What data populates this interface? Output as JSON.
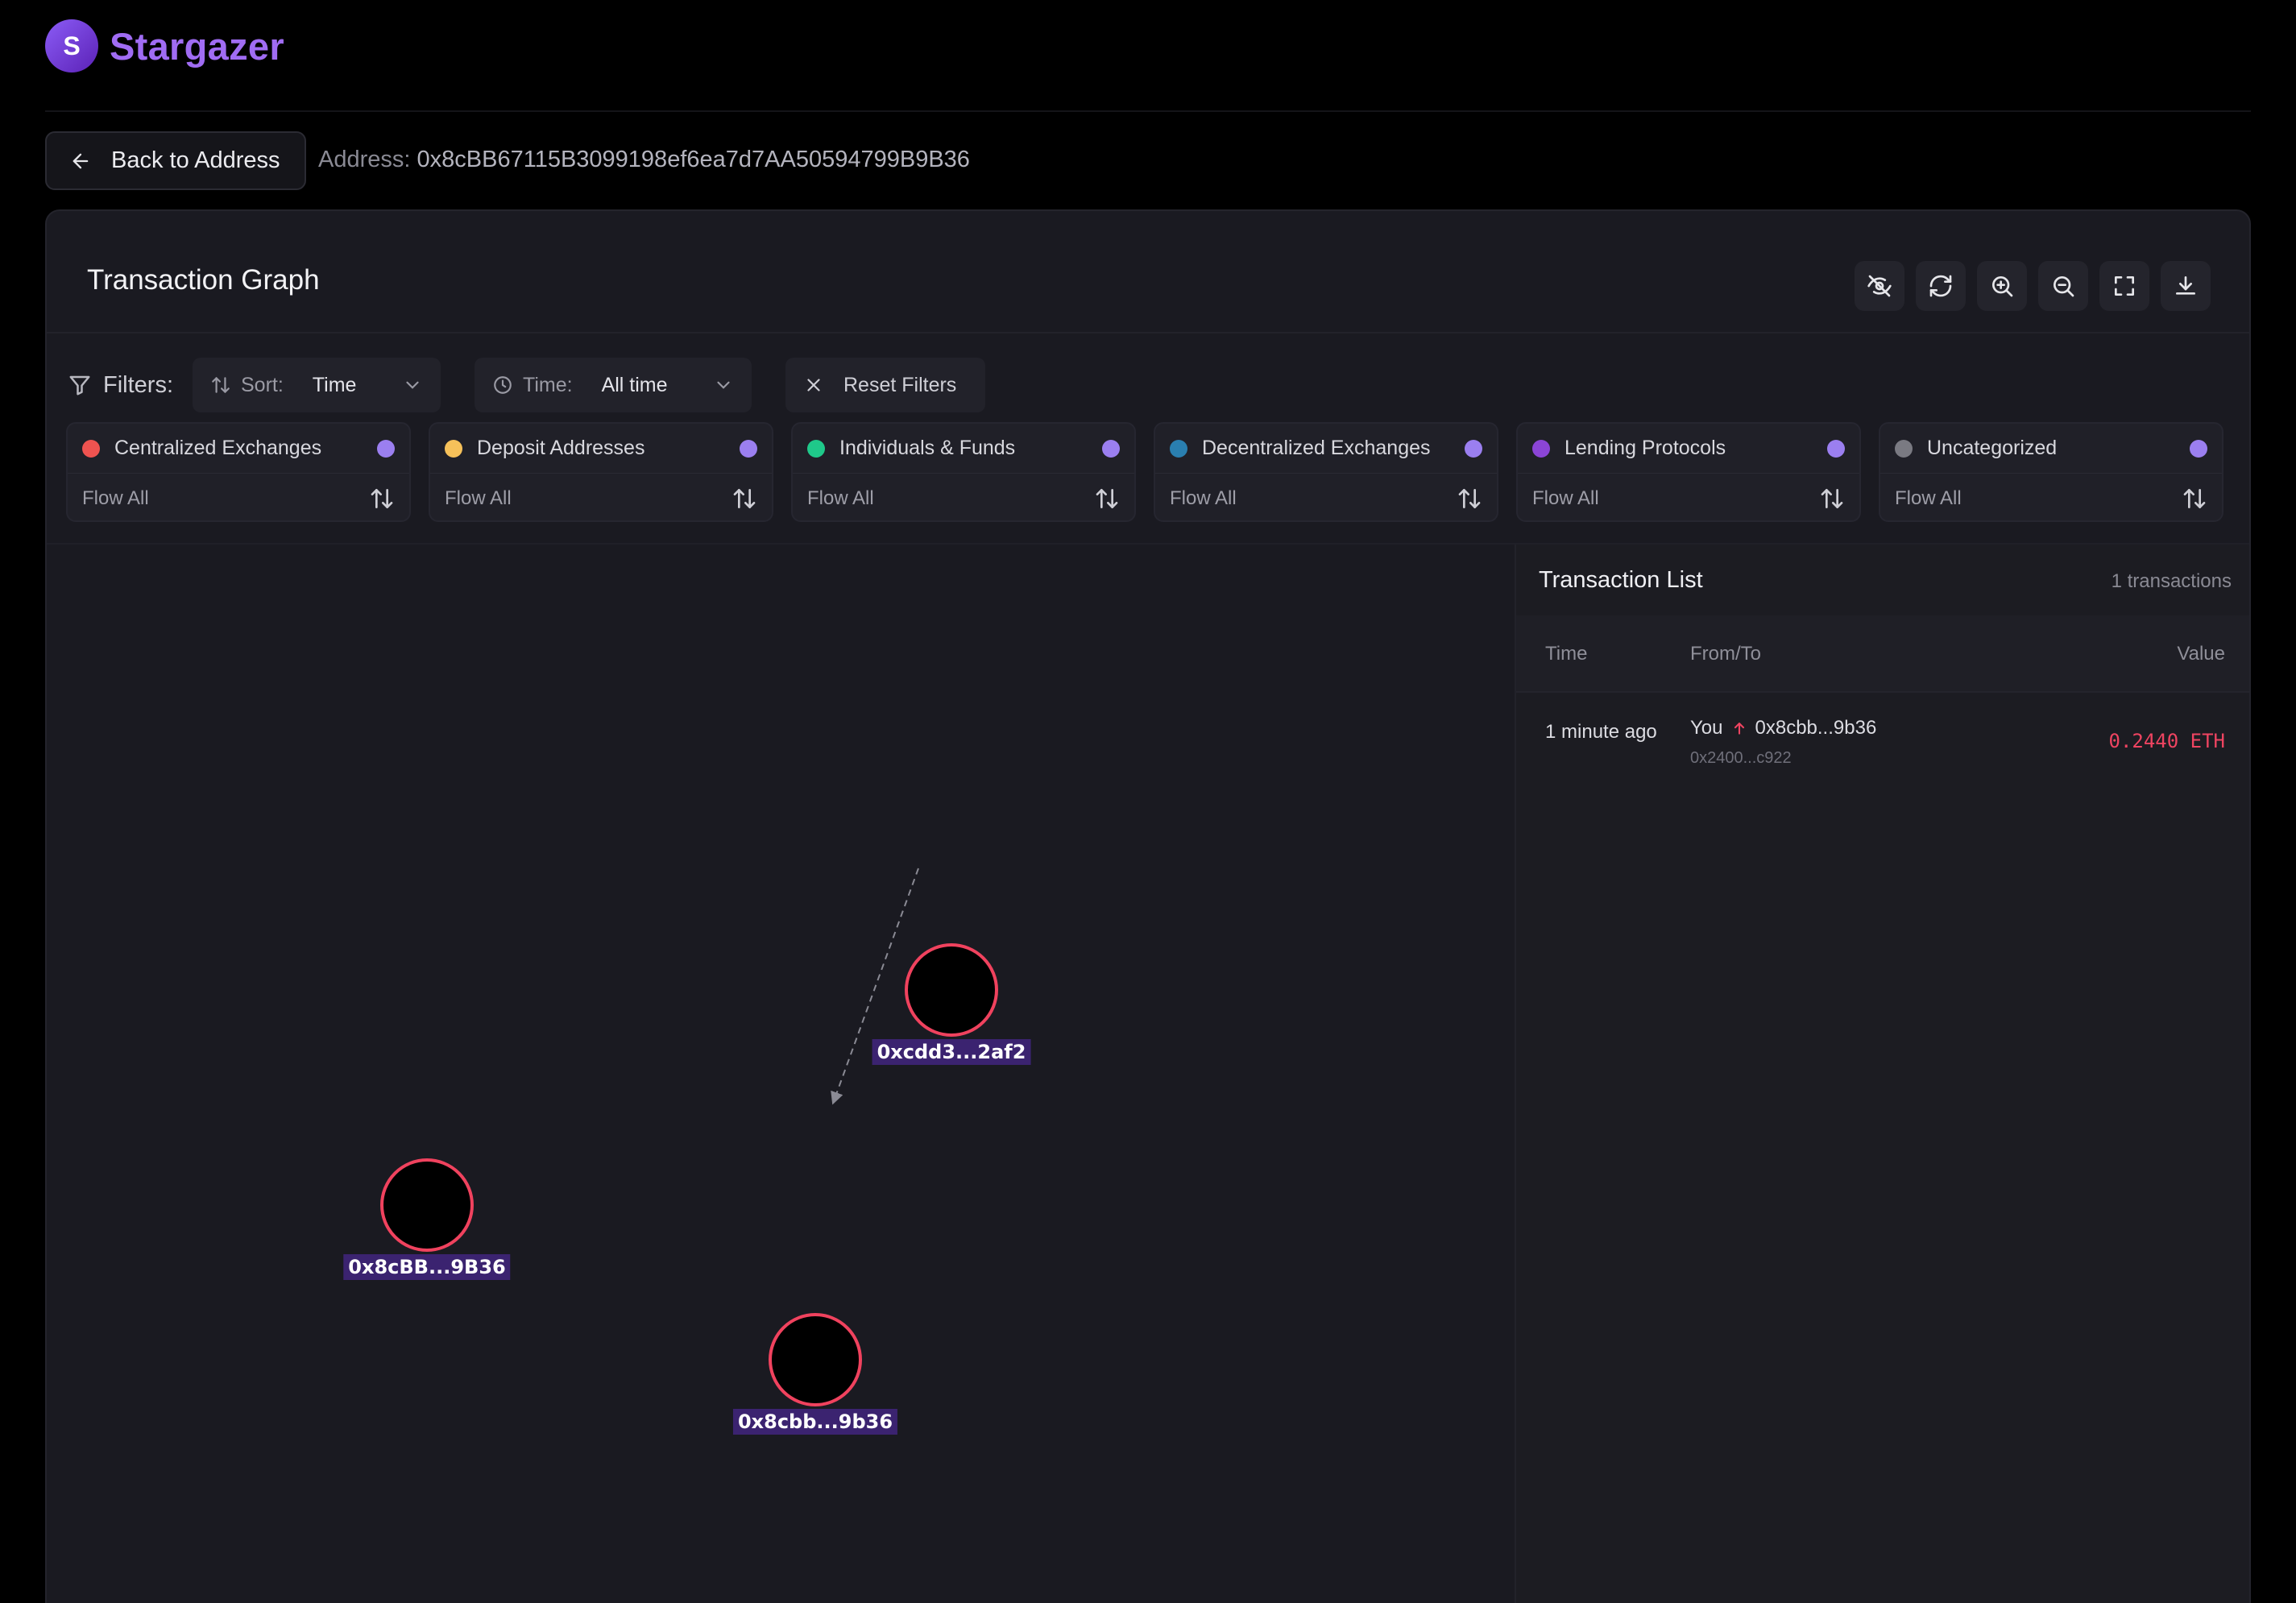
{
  "app": {
    "logo_letter": "S",
    "brand_name": "Stargazer"
  },
  "nav": {
    "back_label": "Back to Address",
    "address_prefix": "Address:",
    "address_value": "0x8cBB67115B3099198ef6ea7d7AA50594799B9B36"
  },
  "card": {
    "title": "Transaction Graph",
    "toolbar_icons": [
      "eye-off-icon",
      "refresh-icon",
      "zoom-in-icon",
      "zoom-out-icon",
      "fullscreen-icon",
      "download-icon"
    ]
  },
  "filters": {
    "label": "Filters:",
    "sort_label": "Sort:",
    "sort_value": "Time",
    "time_label": "Time:",
    "time_value": "All time",
    "reset_label": "Reset Filters"
  },
  "categories": [
    {
      "name": "Centralized Exchanges",
      "color": "#ef5350",
      "flow": "Flow All"
    },
    {
      "name": "Deposit Addresses",
      "color": "#f6c15a",
      "flow": "Flow All"
    },
    {
      "name": "Individuals & Funds",
      "color": "#1fc98a",
      "flow": "Flow All"
    },
    {
      "name": "Decentralized Exchanges",
      "color": "#2a7fb0",
      "flow": "Flow All"
    },
    {
      "name": "Lending Protocols",
      "color": "#8b45d6",
      "flow": "Flow All"
    },
    {
      "name": "Uncategorized",
      "color": "#7a7a82",
      "flow": "Flow All"
    }
  ],
  "graph": {
    "nodes": [
      {
        "label": "0xcdd3...2af2"
      },
      {
        "label": "0x8cBB...9B36"
      },
      {
        "label": "0x8cbb...9b36"
      }
    ],
    "node_stroke": "#f0425e",
    "edge_color": "#8a8a94"
  },
  "transactions": {
    "title": "Transaction List",
    "count": "1 transactions",
    "headers": {
      "time": "Time",
      "from_to": "From/To",
      "value": "Value"
    },
    "rows": [
      {
        "time": "1 minute ago",
        "from": "You",
        "to": "0x8cbb...9b36",
        "sub": "0x2400...c922",
        "value": "0.2440 ETH"
      }
    ]
  },
  "colors": {
    "accent": "#a06cf3",
    "negative": "#ef4461",
    "background": "#000000",
    "card": "#1a1a21"
  }
}
